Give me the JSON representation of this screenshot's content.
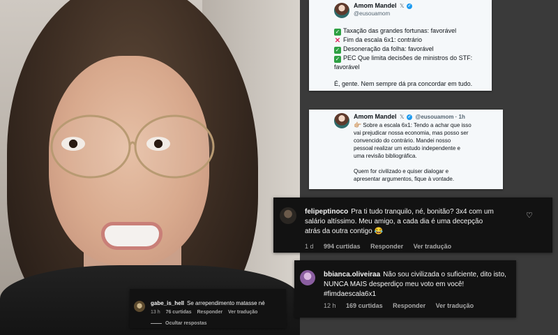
{
  "tweet1": {
    "name": "Amom Mandel",
    "handle": "@eusouamom",
    "lines": [
      {
        "mark": "ok",
        "text": "Taxação das grandes fortunas: favorável"
      },
      {
        "mark": "no",
        "text": "Fim da escala 6x1: contrário"
      },
      {
        "mark": "ok",
        "text": "Desoneração da folha: favorável"
      },
      {
        "mark": "ok",
        "text": "PEC Que limita decisões de ministros do STF:"
      },
      {
        "mark": "",
        "text": "favorável"
      }
    ],
    "closing": "É, gente. Nem sempre dá pra concordar em tudo."
  },
  "tweet2": {
    "name": "Amom Mandel",
    "handle_time": "@eusouamom · 1h",
    "lines": [
      "Sobre a escala 6x1: Tendo a achar que isso",
      "vai prejudicar nossa economia, mas posso ser",
      "convencido do contrário. Mandei nosso",
      "pessoal realizar um estudo independente e",
      "uma revisão bibliográfica."
    ],
    "closing_lines": [
      "Quem for civilizado e quiser dialogar e",
      "apresentar argumentos, fique à vontade."
    ]
  },
  "comment_felipe": {
    "username": "felipeptinoco",
    "lines": [
      "Pra ti tudo tranquilo, né, bonitão? 3x4 com um",
      "salário altíssimo. Meu amigo, a cada dia é uma decepção",
      "atrás da outra contigo 😂"
    ],
    "time": "1 d",
    "likes": "994 curtidas",
    "reply": "Responder",
    "translate": "Ver tradução"
  },
  "comment_bianca": {
    "username": "bbianca.oliveiraa",
    "lines": [
      "Não sou civilizada o suficiente, dito isto,",
      "NUNCA MAIS desperdiço meu voto em você!",
      "#fimdaescala6x1"
    ],
    "time": "12 h",
    "likes": "169 curtidas",
    "reply": "Responder",
    "translate": "Ver tradução"
  },
  "comment_gabe": {
    "username": "gabe_is_hell",
    "text": "Se arrependimento matasse né",
    "time": "13 h",
    "likes": "76 curtidas",
    "reply": "Responder",
    "translate": "Ver tradução",
    "hide_replies": "Ocultar respostas"
  },
  "colors": {
    "verified": "#1d9bf0",
    "check": "#2ea043",
    "cross": "#e0245e",
    "comment_bg": "#121212"
  }
}
